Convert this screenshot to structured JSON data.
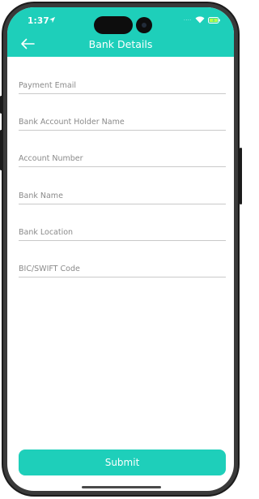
{
  "status_bar": {
    "time": "1:37",
    "location_icon": "location-arrow-icon",
    "signal_text": "····",
    "wifi_icon": "wifi-icon",
    "battery_icon": "battery-charging-icon"
  },
  "header": {
    "title": "Bank Details",
    "back_icon": "arrow-left-icon",
    "background_color": "#1ecfba"
  },
  "form": {
    "fields": [
      {
        "placeholder": "Payment Email",
        "value": ""
      },
      {
        "placeholder": "Bank Account Holder Name",
        "value": ""
      },
      {
        "placeholder": "Account Number",
        "value": ""
      },
      {
        "placeholder": "Bank Name",
        "value": ""
      },
      {
        "placeholder": "Bank Location",
        "value": ""
      },
      {
        "placeholder": "BIC/SWIFT Code",
        "value": ""
      }
    ]
  },
  "submit": {
    "label": "Submit",
    "color": "#1ecfba"
  }
}
